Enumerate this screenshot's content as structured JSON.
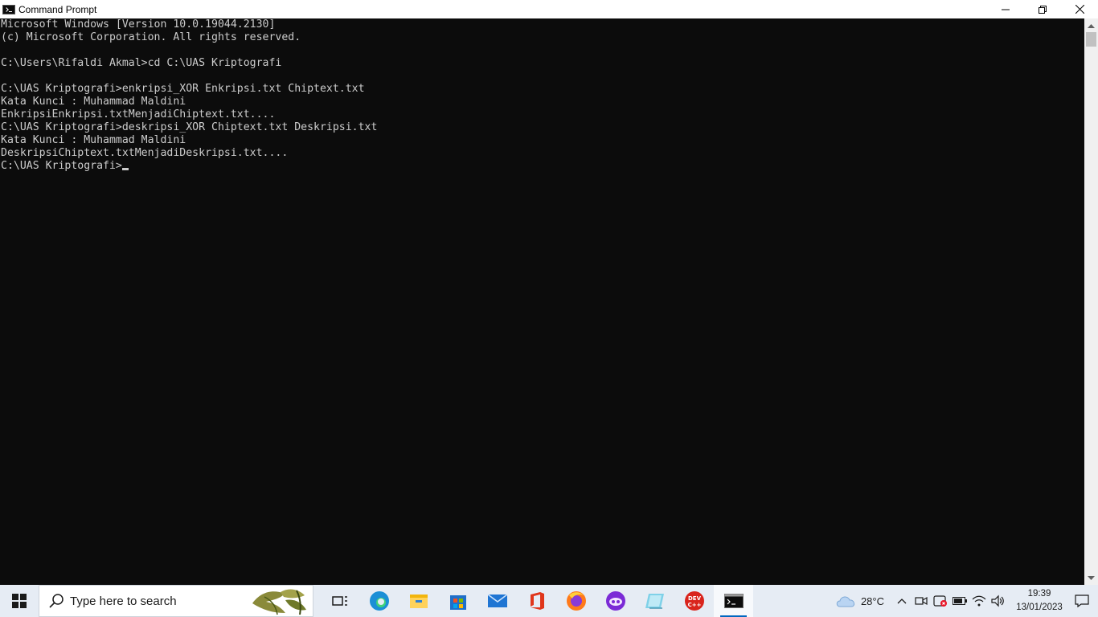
{
  "window": {
    "title": "Command Prompt",
    "minimize_label": "minimize",
    "restore_label": "restore",
    "close_label": "close"
  },
  "console": {
    "lines": [
      "Microsoft Windows [Version 10.0.19044.2130]",
      "(c) Microsoft Corporation. All rights reserved.",
      "",
      "C:\\Users\\Rifaldi Akmal>cd C:\\UAS Kriptografi",
      "",
      "C:\\UAS Kriptografi>enkripsi_XOR Enkripsi.txt Chiptext.txt",
      "Kata Kunci : Muhammad Maldini",
      "EnkripsiEnkripsi.txtMenjadiChiptext.txt....",
      "C:\\UAS Kriptografi>deskripsi_XOR Chiptext.txt Deskripsi.txt",
      "Kata Kunci : Muhammad Maldini",
      "DeskripsiChiptext.txtMenjadiDeskripsi.txt....",
      "C:\\UAS Kriptografi>"
    ]
  },
  "taskbar": {
    "search_placeholder": "Type here to search",
    "apps": [
      {
        "name": "task-view-icon"
      },
      {
        "name": "edge-icon"
      },
      {
        "name": "file-explorer-icon"
      },
      {
        "name": "microsoft-store-icon"
      },
      {
        "name": "mail-icon"
      },
      {
        "name": "office-icon"
      },
      {
        "name": "firefox-icon"
      },
      {
        "name": "game-icon"
      },
      {
        "name": "notepad-icon"
      },
      {
        "name": "dev-cpp-icon",
        "label": "DEV C++"
      },
      {
        "name": "command-prompt-icon"
      }
    ],
    "weather_temp": "28°C",
    "time": "19:39",
    "date": "13/01/2023"
  },
  "colors": {
    "console_bg": "#0c0c0c",
    "console_text": "#cccccc",
    "taskbar_bg": "#e6ecf4",
    "accent": "#0067c0"
  }
}
